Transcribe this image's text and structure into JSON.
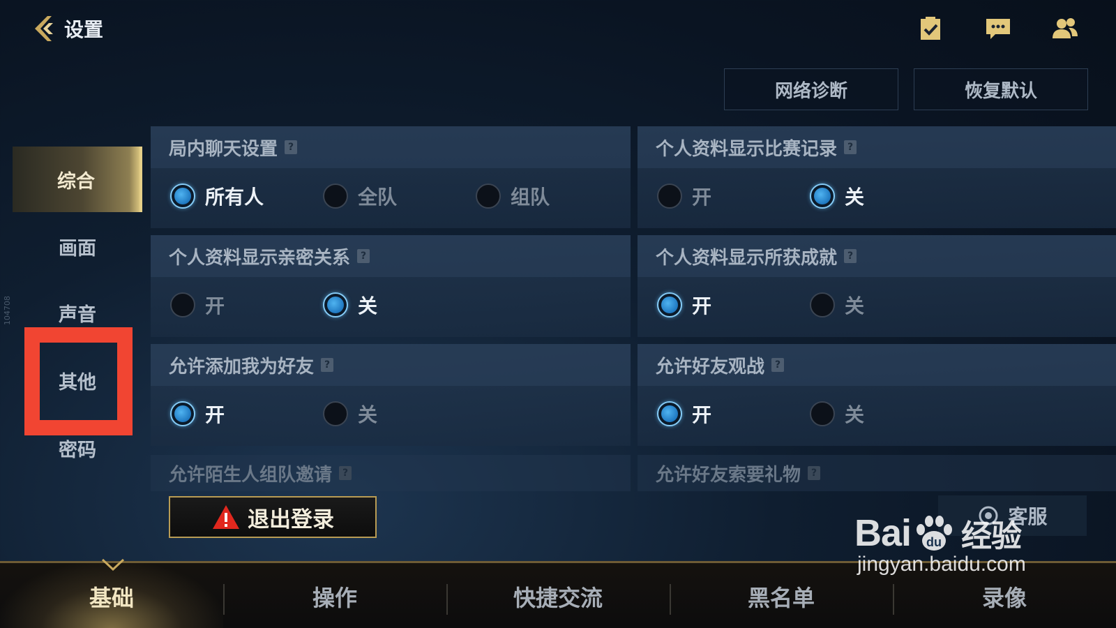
{
  "header": {
    "title": "设置",
    "icons": [
      "checklist-icon",
      "chat-icon",
      "friends-icon"
    ]
  },
  "toolbar": {
    "network_diagnosis": "网络诊断",
    "restore_default": "恢复默认"
  },
  "sidebar": {
    "items": [
      {
        "label": "综合",
        "active": true
      },
      {
        "label": "画面",
        "active": false
      },
      {
        "label": "声音",
        "active": false
      },
      {
        "label": "其他",
        "active": false
      },
      {
        "label": "密码",
        "active": false
      }
    ],
    "version": "104708"
  },
  "panels": {
    "chat": {
      "title": "局内聊天设置",
      "help": "?",
      "options": [
        {
          "label": "所有人",
          "selected": true
        },
        {
          "label": "全队",
          "selected": false
        },
        {
          "label": "组队",
          "selected": false
        }
      ]
    },
    "match_record": {
      "title": "个人资料显示比赛记录",
      "help": "?",
      "options": [
        {
          "label": "开",
          "selected": false
        },
        {
          "label": "关",
          "selected": true
        }
      ]
    },
    "intimacy": {
      "title": "个人资料显示亲密关系",
      "help": "?",
      "options": [
        {
          "label": "开",
          "selected": false
        },
        {
          "label": "关",
          "selected": true
        }
      ]
    },
    "achievement": {
      "title": "个人资料显示所获成就",
      "help": "?",
      "options": [
        {
          "label": "开",
          "selected": true
        },
        {
          "label": "关",
          "selected": false
        }
      ]
    },
    "add_friend": {
      "title": "允许添加我为好友",
      "help": "?",
      "options": [
        {
          "label": "开",
          "selected": true
        },
        {
          "label": "关",
          "selected": false
        }
      ]
    },
    "spectate": {
      "title": "允许好友观战",
      "help": "?",
      "options": [
        {
          "label": "开",
          "selected": true
        },
        {
          "label": "关",
          "selected": false
        }
      ]
    },
    "stranger_invite": {
      "title": "允许陌生人组队邀请",
      "help": "?"
    },
    "gift_request": {
      "title": "允许好友索要礼物",
      "help": "?"
    }
  },
  "actions": {
    "logout": "退出登录",
    "customer_service": "客服"
  },
  "bottom_nav": {
    "items": [
      {
        "label": "基础",
        "active": true
      },
      {
        "label": "操作",
        "active": false
      },
      {
        "label": "快捷交流",
        "active": false
      },
      {
        "label": "黑名单",
        "active": false
      },
      {
        "label": "录像",
        "active": false
      }
    ]
  },
  "watermark": {
    "brand_left": "Bai",
    "brand_right": "经验",
    "url": "jingyan.baidu.com"
  },
  "colors": {
    "accent_gold": "#d8c37d",
    "radio_on": "#4fb3f0",
    "highlight_red": "#f14532",
    "warning_red": "#e0281e"
  }
}
